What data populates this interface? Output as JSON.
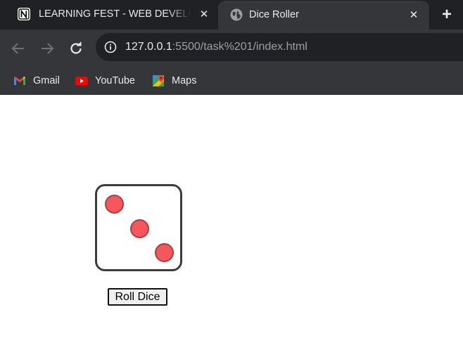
{
  "browser": {
    "tabs": [
      {
        "title": "LEARNING FEST - WEB DEVELOP",
        "favicon": "notion-icon",
        "active": false
      },
      {
        "title": "Dice Roller",
        "favicon": "globe-icon",
        "active": true
      }
    ],
    "address_bar": {
      "host": "127.0.0.1",
      "rest": ":5500/task%201/index.html"
    },
    "bookmarks": [
      {
        "label": "Gmail",
        "icon": "gmail-icon"
      },
      {
        "label": "YouTube",
        "icon": "youtube-icon"
      },
      {
        "label": "Maps",
        "icon": "maps-icon"
      }
    ]
  },
  "page": {
    "die_face_value": 3,
    "pip_color": "#f4585c",
    "roll_button_label": "Roll Dice"
  }
}
